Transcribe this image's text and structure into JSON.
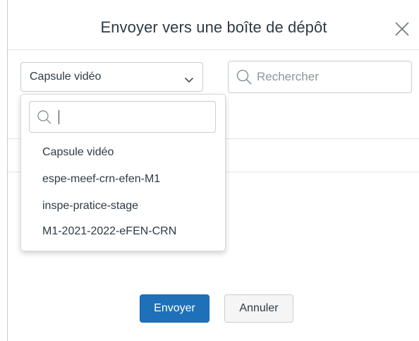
{
  "dialog": {
    "title": "Envoyer vers une boîte de dépôt",
    "close_icon": "close-icon"
  },
  "folder_select": {
    "selected": "Capsule vidéo",
    "chevron_icon": "chevron-down-icon"
  },
  "search": {
    "placeholder": "Rechercher",
    "icon": "search-icon"
  },
  "dropdown": {
    "search_value": "",
    "search_icon": "search-icon",
    "items": [
      {
        "label": "Capsule vidéo"
      },
      {
        "label": "espe-meef-crn-efen-M1"
      },
      {
        "label": "inspe-pratice-stage"
      },
      {
        "label": "M1-2021-2022-eFEN-CRN"
      }
    ]
  },
  "actions": {
    "send_label": "Envoyer",
    "cancel_label": "Annuler"
  },
  "colors": {
    "primary": "#1e71b8",
    "text": "#2d3b45",
    "border": "#c7cdd1"
  }
}
